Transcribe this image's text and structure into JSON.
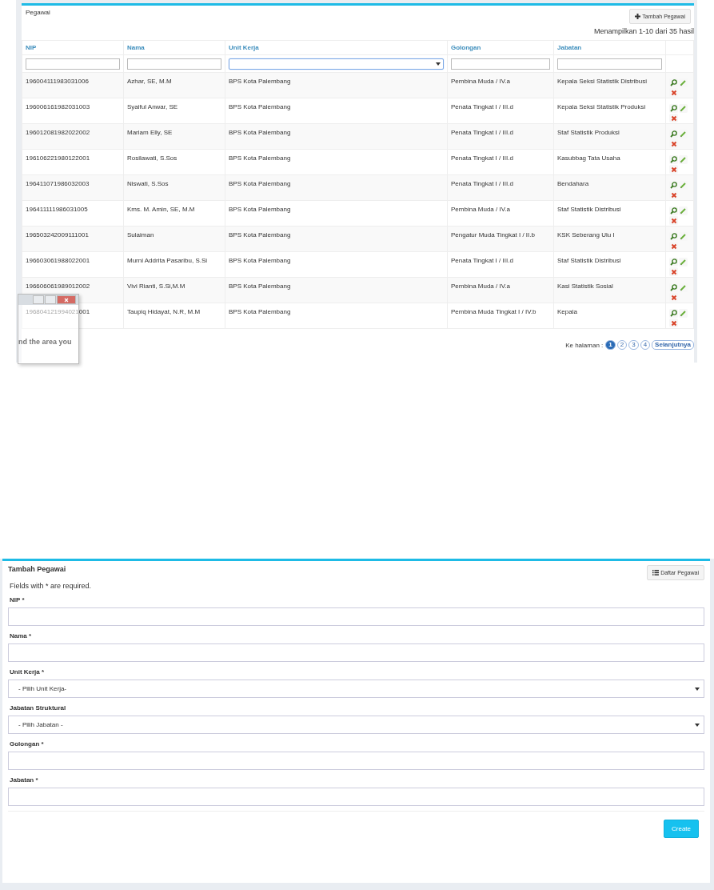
{
  "list_panel": {
    "title": "Pegawai",
    "add_button": "Tambah Pegawai",
    "summary": "Menampilkan 1-10 dari 35 hasil",
    "columns": [
      "NIP",
      "Nama",
      "Unit Kerja",
      "Golongan",
      "Jabatan"
    ],
    "filters": [
      {
        "kind": "text",
        "focused": false
      },
      {
        "kind": "text",
        "focused": false
      },
      {
        "kind": "select",
        "focused": true
      },
      {
        "kind": "text",
        "focused": false
      },
      {
        "kind": "text",
        "focused": false
      }
    ],
    "rows": [
      {
        "nip": "196004111983031006",
        "nama": "Azhar, SE, M.M",
        "unit_kerja": "BPS Kota Palembang",
        "golongan": "Pembina Muda / IV.a",
        "jabatan": "Kepala Seksi Statistik Distribusi"
      },
      {
        "nip": "196006161982031003",
        "nama": "Syaiful Anwar, SE",
        "unit_kerja": "BPS Kota Palembang",
        "golongan": "Penata Tingkat I / III.d",
        "jabatan": "Kepala Seksi Statistik Produksi"
      },
      {
        "nip": "196012081982022002",
        "nama": "Mariam Elly, SE",
        "unit_kerja": "BPS Kota Palembang",
        "golongan": "Penata Tingkat I / III.d",
        "jabatan": "Staf Statistik Produksi"
      },
      {
        "nip": "196106221980122001",
        "nama": "Rosilawati, S.Sos",
        "unit_kerja": "BPS Kota Palembang",
        "golongan": "Penata Tingkat I / III.d",
        "jabatan": "Kasubbag Tata Usaha"
      },
      {
        "nip": "196411071986032003",
        "nama": "Niswati, S.Sos",
        "unit_kerja": "BPS Kota Palembang",
        "golongan": "Penata Tingkat I / III.d",
        "jabatan": "Bendahara"
      },
      {
        "nip": "196411111986031005",
        "nama": "Kms. M. Amin, SE, M.M",
        "unit_kerja": "BPS Kota Palembang",
        "golongan": "Pembina Muda / IV.a",
        "jabatan": "Staf Statistik Distribusi"
      },
      {
        "nip": "196503242009111001",
        "nama": "Sulaiman",
        "unit_kerja": "BPS Kota Palembang",
        "golongan": "Pengatur Muda Tingkat I / II.b",
        "jabatan": "KSK Seberang Ulu I"
      },
      {
        "nip": "196603061988022001",
        "nama": "Murni Addrita Pasaribu, S.Si",
        "unit_kerja": "BPS Kota Palembang",
        "golongan": "Penata Tingkat I / III.d",
        "jabatan": "Staf Statistik Distribusi"
      },
      {
        "nip": "196606061989012002",
        "nama": "Vivi Rianti, S.Si,M.M",
        "unit_kerja": "BPS Kota Palembang",
        "golongan": "Pembina Muda / IV.a",
        "jabatan": "Kasi Statistik Sosial"
      },
      {
        "nip": "196804121994021001",
        "nama": "Taupiq Hidayat, N.R, M.M",
        "unit_kerja": "BPS Kota Palembang",
        "golongan": "Pembina Muda Tingkat I / IV.b",
        "jabatan": "Kepala"
      }
    ],
    "pagination": {
      "label": "Ke halaman :",
      "pages": [
        {
          "label": "1",
          "selected": true
        },
        {
          "label": "2",
          "selected": false
        },
        {
          "label": "3",
          "selected": false
        },
        {
          "label": "4",
          "selected": false
        }
      ],
      "next": "Selanjutnya"
    }
  },
  "overlay_window": {
    "text": "nd the area you"
  },
  "form_panel": {
    "title": "Tambah Pegawai",
    "list_button": "Daftar Pegawai",
    "note": "Fields with * are required.",
    "fields": [
      {
        "label": "NIP *",
        "kind": "text"
      },
      {
        "label": "Nama *",
        "kind": "text"
      },
      {
        "label": "Unit Kerja *",
        "kind": "select",
        "placeholder": "- Pilih Unit Kerja-"
      },
      {
        "label": "Jabatan Struktural",
        "kind": "select",
        "placeholder": "- Pilih Jabatan -"
      },
      {
        "label": "Golongan *",
        "kind": "text"
      },
      {
        "label": "Jabatan *",
        "kind": "text"
      }
    ],
    "submit": "Create"
  }
}
